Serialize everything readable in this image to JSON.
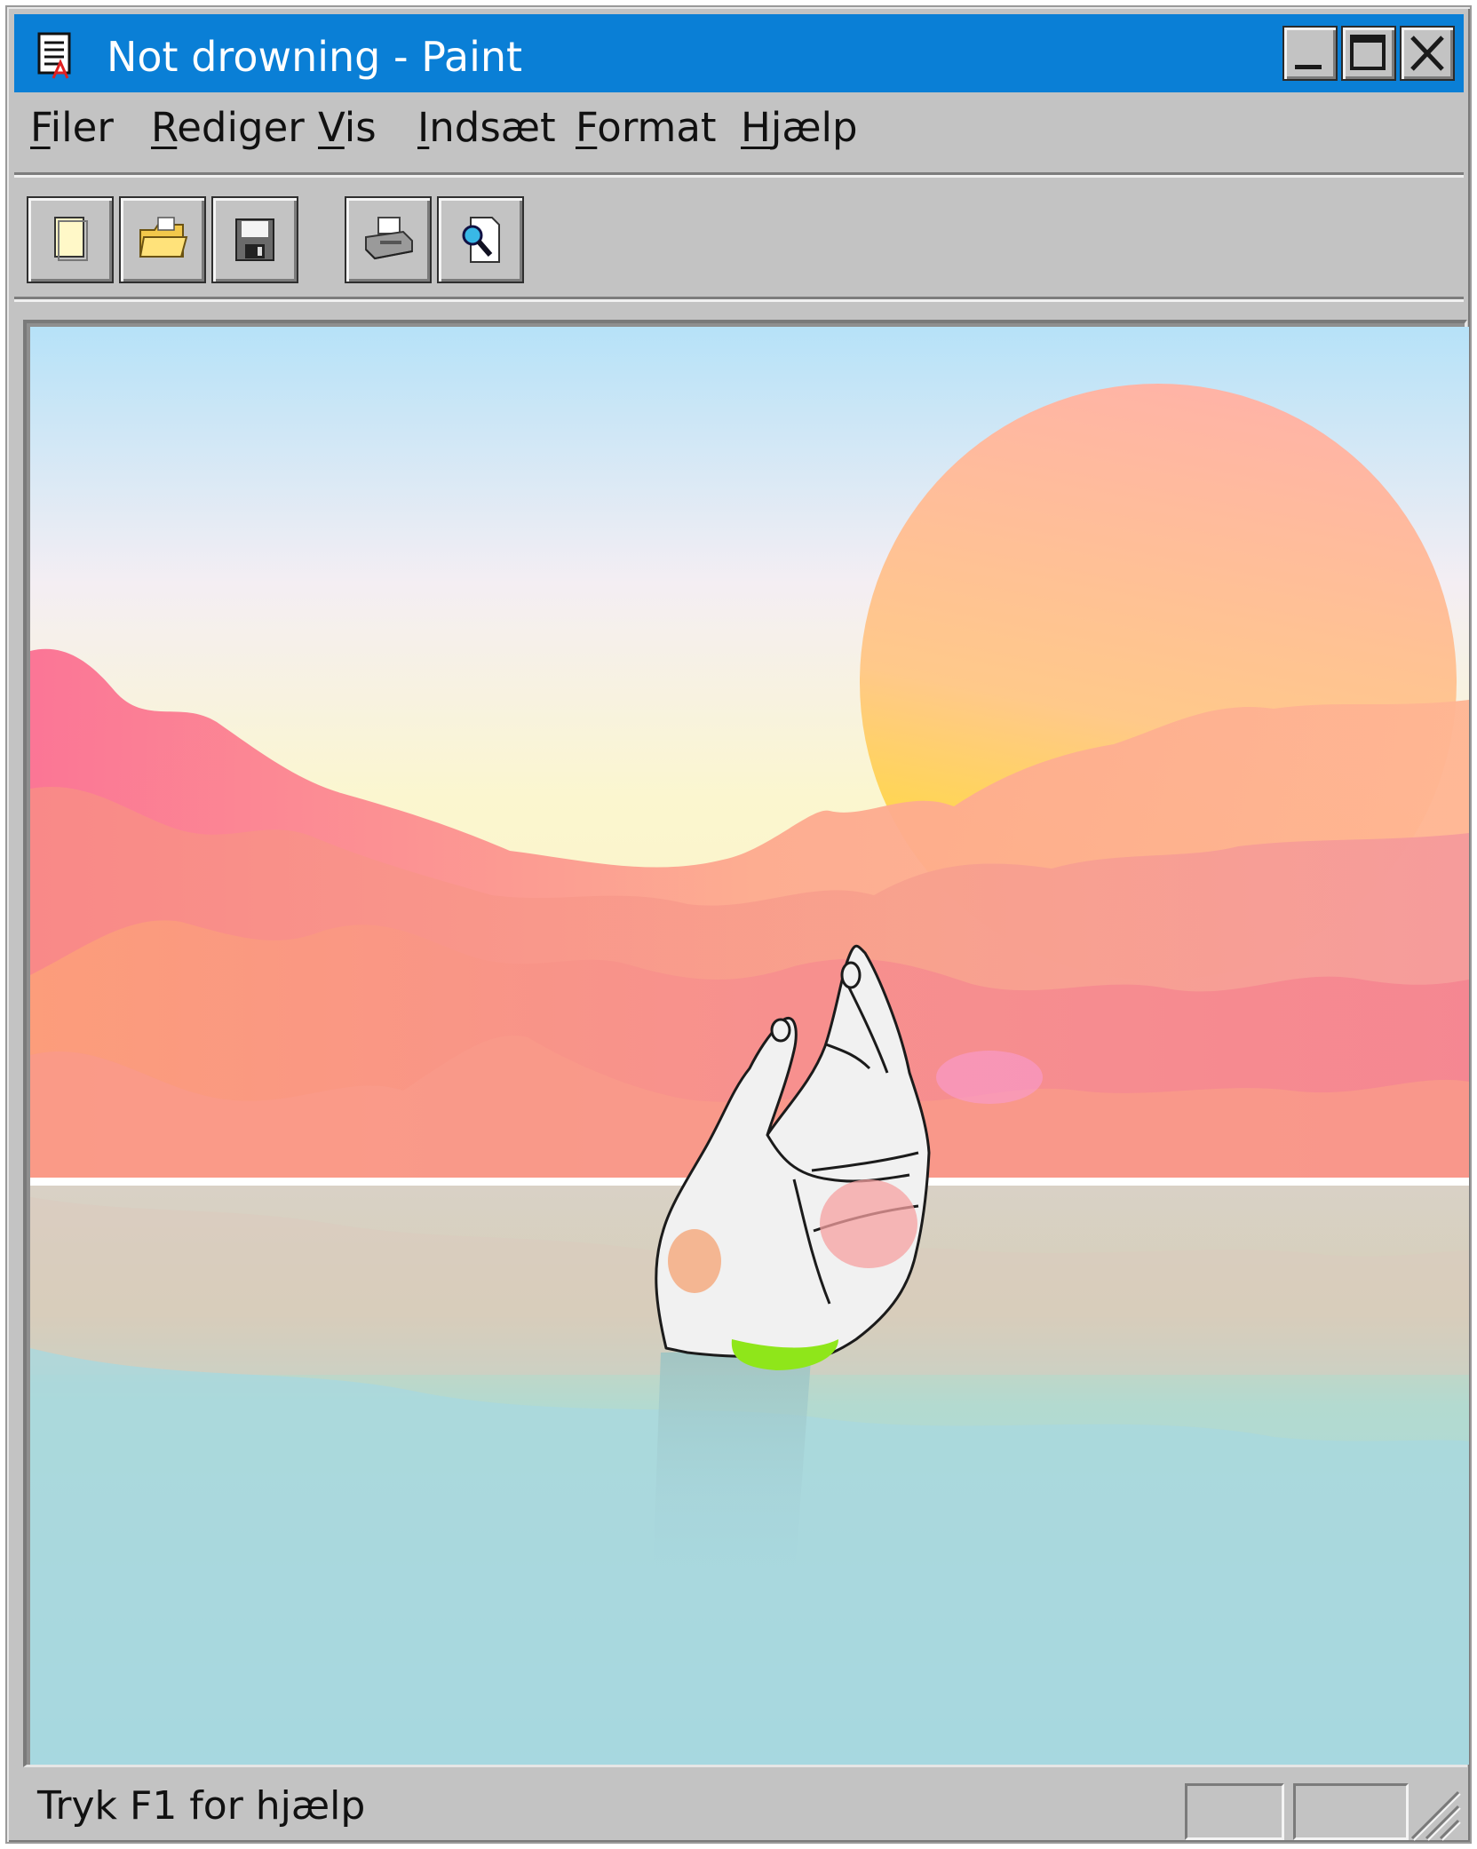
{
  "window": {
    "title": "Not drowning - Paint",
    "title_icon": "paint-document-icon",
    "controls": [
      "minimize-icon",
      "maximize-icon",
      "close-icon"
    ]
  },
  "menu": {
    "items": [
      {
        "mnemonic": "F",
        "rest": "iler"
      },
      {
        "mnemonic": "R",
        "rest": "ediger"
      },
      {
        "mnemonic": "V",
        "rest": "is"
      },
      {
        "mnemonic": "I",
        "rest": "ndsæt"
      },
      {
        "mnemonic": "F",
        "rest": "ormat"
      },
      {
        "mnemonic": "H",
        "rest": "jælp"
      }
    ]
  },
  "toolbar": {
    "buttons": [
      "new-document-icon",
      "open-folder-icon",
      "save-disk-icon",
      "print-icon",
      "print-preview-icon"
    ]
  },
  "canvas": {
    "image": "hand-rising-from-water-sunset-illustration",
    "colors": {
      "sky_top": "#b6e2f8",
      "sky_horizon": "#fbf6cf",
      "sun_top": "#ffb4a6",
      "sun_bottom": "#ffe31a",
      "clouds": "#f79a90",
      "water": "#a6d6e2",
      "hand": "#f2f2f2",
      "cuff": "#8fe61a"
    }
  },
  "statusbar": {
    "help_text": "Tryk F1 for hjælp"
  },
  "colors": {
    "title_bar": "#0a7fd6",
    "chrome": "#c3c3c3"
  }
}
